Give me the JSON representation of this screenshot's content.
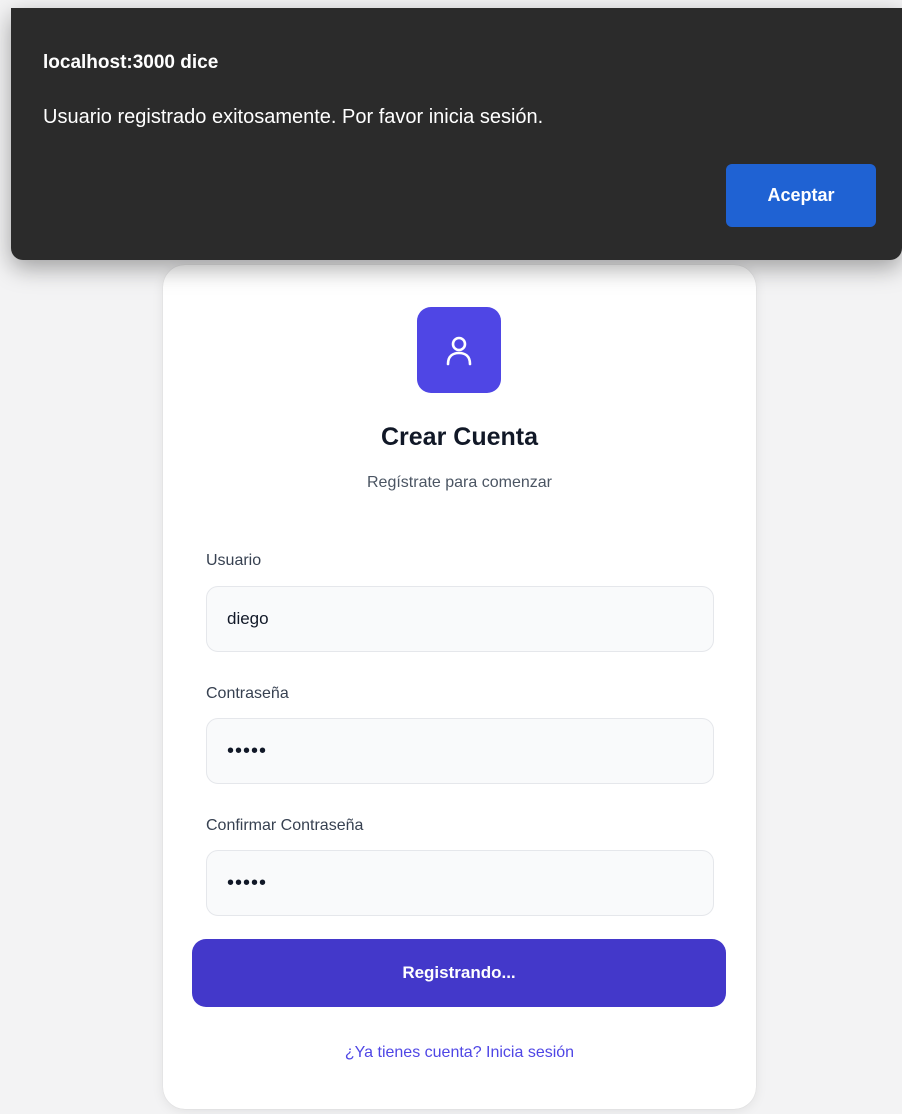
{
  "dialog": {
    "title": "localhost:3000 dice",
    "message": "Usuario registrado exitosamente. Por favor inicia sesión.",
    "accept_label": "Aceptar"
  },
  "card": {
    "icon": "user-icon",
    "title": "Crear Cuenta",
    "subtitle": "Regístrate para comenzar",
    "fields": {
      "username": {
        "label": "Usuario",
        "value": "diego"
      },
      "password": {
        "label": "Contraseña",
        "value": "•••••"
      },
      "confirm_password": {
        "label": "Confirmar Contraseña",
        "value": "•••••"
      }
    },
    "submit_label": "Registrando...",
    "login_link": "¿Ya tienes cuenta? Inicia sesión"
  },
  "colors": {
    "accent": "#4f46e5",
    "button": "#4338ca",
    "dialog_bg": "#2b2b2b",
    "dialog_button": "#1f62d3"
  }
}
